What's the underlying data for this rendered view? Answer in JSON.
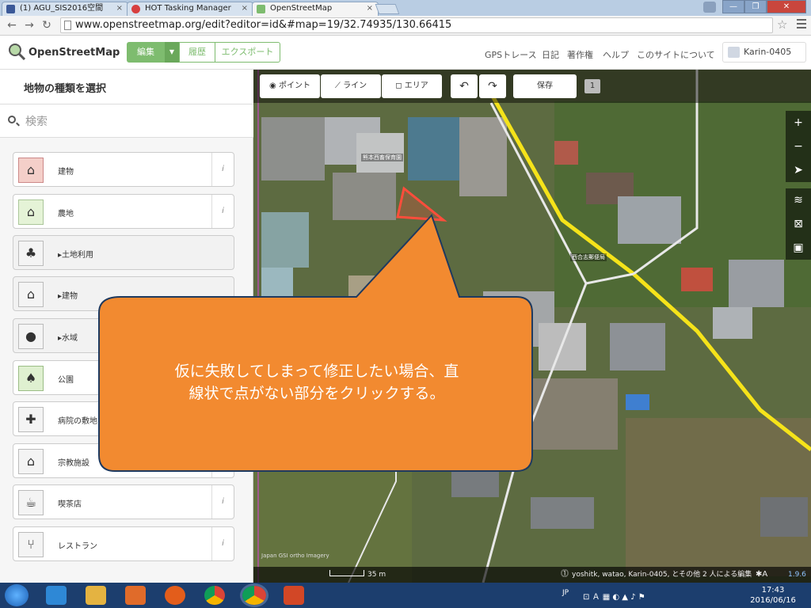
{
  "browser": {
    "tabs": [
      {
        "label": "(1) AGU_SIS2016空間",
        "close": "×"
      },
      {
        "label": "HOT Tasking Manager",
        "close": "×"
      },
      {
        "label": "OpenStreetMap",
        "close": "×"
      }
    ],
    "url": "www.openstreetmap.org/edit?editor=id&#map=19/32.74935/130.66415",
    "window_controls": [
      "—",
      "❐",
      "✕"
    ]
  },
  "osm_header": {
    "brand": "OpenStreetMap",
    "edit_label": "編集",
    "history_label": "履歴",
    "export_label": "エクスポート",
    "links": [
      "GPSトレース",
      "日記",
      "著作権",
      "ヘルプ",
      "このサイトについて"
    ],
    "user": "Karin-0405"
  },
  "sidebar": {
    "title": "地物の種類を選択",
    "search_placeholder": "検索",
    "info_glyph": "i",
    "presets": [
      {
        "label": "建物",
        "icon": "building-icon",
        "glyph": "⌂"
      },
      {
        "label": "農地",
        "icon": "farm-icon",
        "glyph": "⌂"
      },
      {
        "label": "▸土地利用",
        "icon": "landuse-icon",
        "glyph": "♣"
      },
      {
        "label": "▸建物",
        "icon": "building-group-icon",
        "glyph": "⌂"
      },
      {
        "label": "▸水域",
        "icon": "water-icon",
        "glyph": "●"
      },
      {
        "label": "公園",
        "icon": "park-icon",
        "glyph": "♠"
      },
      {
        "label": "病院の敷地",
        "icon": "hospital-icon",
        "glyph": "✚"
      },
      {
        "label": "宗教施設",
        "icon": "religion-icon",
        "glyph": "⌂"
      },
      {
        "label": "喫茶店",
        "icon": "cafe-icon",
        "glyph": "☕"
      },
      {
        "label": "レストラン",
        "icon": "restaurant-icon",
        "glyph": "⑂"
      }
    ]
  },
  "map_toolbar": {
    "point": "ポイント",
    "line": "ライン",
    "area": "エリア",
    "undo": "↶",
    "redo": "↷",
    "save": "保存",
    "save_count": "1"
  },
  "map_labels": {
    "poi1": "熊本西畜保育園",
    "poi2": "西合志郵便局"
  },
  "map_controls": [
    "+",
    "−",
    "➤",
    "≋",
    "⊠",
    "▣"
  ],
  "attribution": {
    "imagery": "Japan GSI ortho Imagery",
    "scale": "35 m",
    "editors": "yoshitk, watao, Karin-0405, とその他 2 人による編集",
    "version": "1.9.6"
  },
  "callout": {
    "line1": "仮に失敗してしまって修正したい場合、直",
    "line2": "線状で点がない部分をクリックする。"
  },
  "taskbar": {
    "lang": "JP",
    "time": "17:43",
    "date": "2016/06/16"
  },
  "colors": {
    "osm_green": "#7ebc6f",
    "callout_fill": "#f28a30",
    "road_yellow": "#f5e31a",
    "selected_area": "#ff4d3b"
  }
}
